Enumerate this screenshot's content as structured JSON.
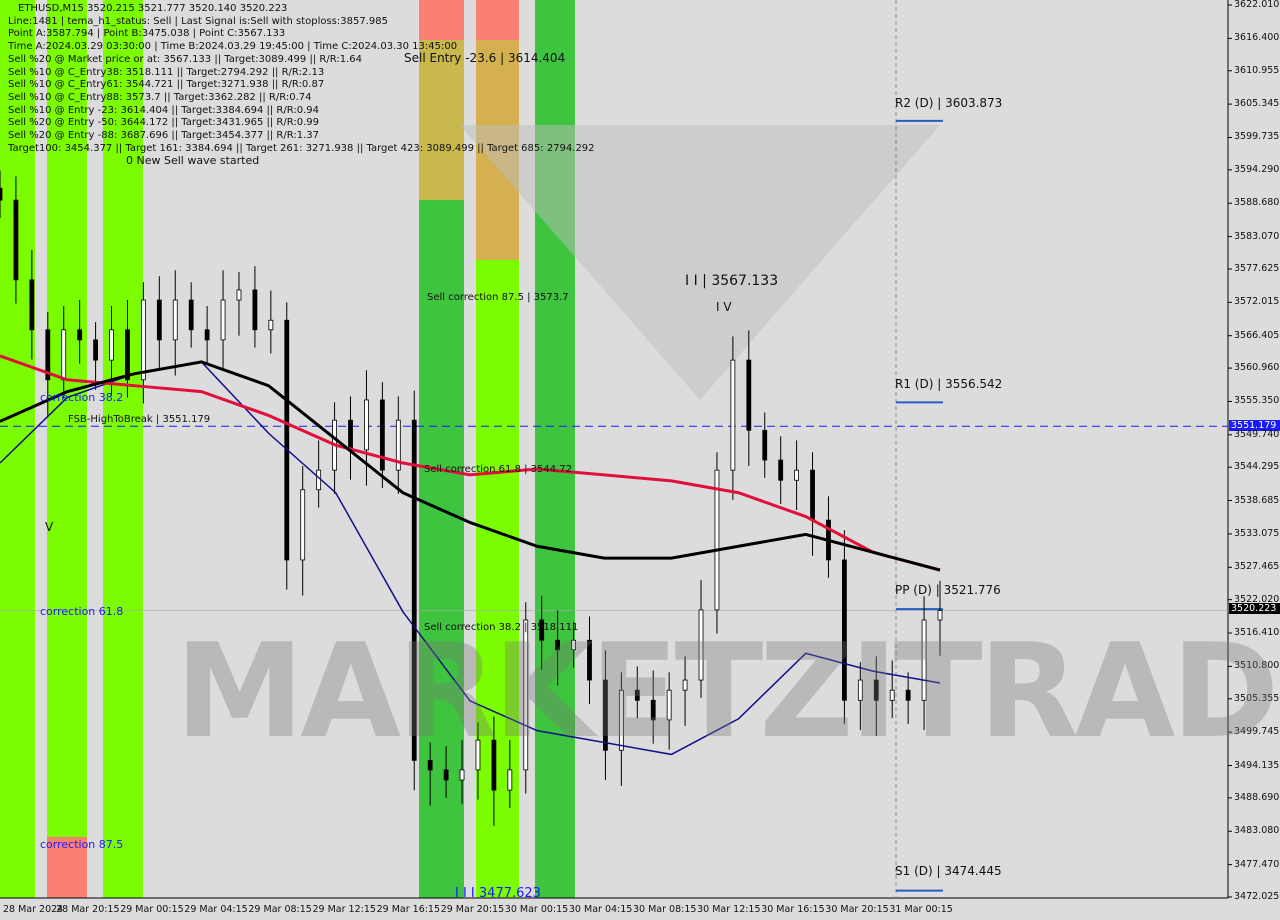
{
  "header": {
    "symbol_line": "ETHUSD,M15  3520.215 3521.777 3520.140 3520.223",
    "lines": [
      "Line:1481 | tema_h1_status: Sell | Last Signal is:Sell with stoploss:3857.985",
      "Point A:3587.794 | Point B:3475.038 | Point C:3567.133",
      "Time A:2024.03.29 03:30:00 | Time B:2024.03.29 19:45:00 | Time C:2024.03.30 13:45:00",
      "Sell %20 @ Market price or at: 3567.133 || Target:3089.499 || R/R:1.64",
      "Sell %10 @ C_Entry38: 3518.111 || Target:2794.292 || R/R:2.13",
      "Sell %10 @ C_Entry61: 3544.721 || Target:3271.938 || R/R:0.87",
      "Sell %10 @ C_Entry88: 3573.7 || Target:3362.282 || R/R:0.74",
      "Sell %10 @ Entry -23: 3614.404 || Target:3384.694 || R/R:0.94",
      "Sell %20 @ Entry -50: 3644.172 || Target:3431.965 || R/R:0.99",
      "Sell %20 @ Entry -88: 3687.696 || Target:3454.377 || R/R:1.37",
      "Target100: 3454.377 || Target 161: 3384.694 || Target 261: 3271.938 || Target 423: 3089.499 || Target 685: 2794.292"
    ],
    "wave_text": "0 New Sell wave started"
  },
  "annotations": {
    "sell_entry": "Sell Entry -23.6 | 3614.404",
    "sell_corr_875": "Sell correction 87.5 | 3573.7",
    "sell_corr_618": "Sell correction 61.8 | 3544.72",
    "sell_corr_382": "Sell correction 38.2 | 3518.111",
    "point_c": "I I | 3567.133",
    "point_c_mark": "I V",
    "point_b": "I I I 3477.623",
    "v_mark": "V",
    "corr_382": "correction 38.2",
    "corr_618": "correction 61.8",
    "corr_875": "correction 87.5",
    "fsb": "FSB-HighToBreak | 3551.179",
    "r2": "R2 (D) | 3603.873",
    "r1": "R1 (D) | 3556.542",
    "pp": "PP (D) | 3521.776",
    "s1": "S1 (D) | 3474.445"
  },
  "watermark": "MARKETZITRADE",
  "price_tags": {
    "fsb": "3551.179",
    "current": "3520.223"
  },
  "colors": {
    "bull_zone": "#7cfc00",
    "bear_zone": "#fa8072",
    "ema_red": "#e0103c",
    "ma_black": "#000000",
    "ma_blue": "#10108c",
    "fsb_line": "#1a1aff",
    "pivot": "#1f5fbf"
  },
  "chart_data": {
    "type": "candlestick",
    "symbol": "ETHUSD",
    "timeframe": "M15",
    "ylim": [
      3472.025,
      3622.01
    ],
    "y_ticks": [
      "3622.010",
      "3616.400",
      "3610.955",
      "3605.345",
      "3599.735",
      "3594.290",
      "3588.680",
      "3583.070",
      "3577.625",
      "3572.015",
      "3566.405",
      "3560.960",
      "3555.350",
      "3549.740",
      "3544.295",
      "3538.685",
      "3533.075",
      "3527.465",
      "3522.020",
      "3516.410",
      "3510.800",
      "3505.355",
      "3499.745",
      "3494.135",
      "3488.690",
      "3483.080",
      "3477.470",
      "3472.025"
    ],
    "x_ticks": [
      "28 Mar 2024",
      "28 Mar 20:15",
      "29 Mar 00:15",
      "29 Mar 04:15",
      "29 Mar 08:15",
      "29 Mar 12:15",
      "29 Mar 16:15",
      "29 Mar 20:15",
      "30 Mar 00:15",
      "30 Mar 04:15",
      "30 Mar 08:15",
      "30 Mar 12:15",
      "30 Mar 16:15",
      "30 Mar 20:15",
      "31 Mar 00:15"
    ],
    "hourly_closes": [
      3589.2,
      3575.8,
      3567.4,
      3559.0,
      3567.4,
      3565.7,
      3562.3,
      3567.4,
      3559.0,
      3572.4,
      3565.7,
      3572.4,
      3567.4,
      3565.7,
      3572.4,
      3574.1,
      3567.4,
      3569.0,
      3528.7,
      3540.5,
      3543.8,
      3552.2,
      3547.2,
      3555.6,
      3543.8,
      3552.2,
      3495.0,
      3493.4,
      3491.7,
      3493.4,
      3498.4,
      3490.0,
      3493.4,
      3518.6,
      3515.2,
      3513.6,
      3515.2,
      3508.5,
      3496.7,
      3506.8,
      3505.1,
      3501.8,
      3506.8,
      3508.5,
      3520.3,
      3543.8,
      3562.3,
      3550.5,
      3545.5,
      3542.1,
      3543.8,
      3535.4,
      3528.7,
      3505.1,
      3508.5,
      3505.1,
      3506.8,
      3505.1,
      3518.6,
      3520.2
    ],
    "ema_red": [
      3563,
      3559,
      3558,
      3557,
      3553,
      3548,
      3545,
      3543,
      3544,
      3543,
      3542,
      3540,
      3536,
      3530,
      3527
    ],
    "ma_black": [
      3552,
      3557,
      3560,
      3562,
      3558,
      3549,
      3540,
      3535,
      3531,
      3529,
      3529,
      3531,
      3533,
      3530,
      3527
    ],
    "ma_blue": [
      3545,
      3556,
      3560,
      3562,
      3550,
      3540,
      3520,
      3505,
      3500,
      3498,
      3496,
      3502,
      3513,
      3510,
      3508
    ],
    "hlines": {
      "fsb": 3551.179,
      "current": 3520.223,
      "r2": 3603.873,
      "r1": 3556.542,
      "pp": 3521.776,
      "s1": 3474.445
    }
  }
}
